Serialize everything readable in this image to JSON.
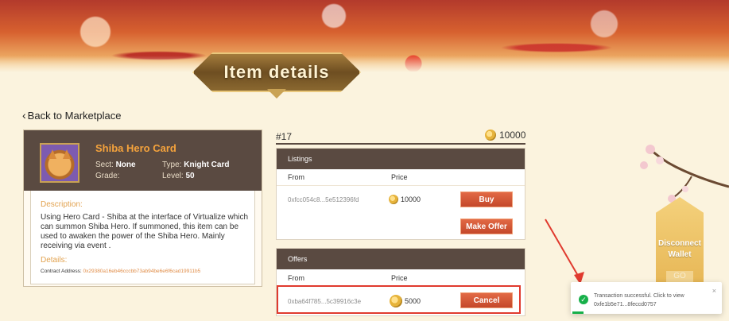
{
  "page": {
    "title": "Item details"
  },
  "nav": {
    "back_label": "Back to Marketplace",
    "back_icon": "chevron-left-icon"
  },
  "hero": {
    "name": "Shiba Hero Card",
    "sect_label": "Sect:",
    "sect_value": "None",
    "type_label": "Type:",
    "type_value": "Knight Card",
    "grade_label": "Grade:",
    "grade_value": "",
    "level_label": "Level:",
    "level_value": "50",
    "description_label": "Description:",
    "description": "Using Hero Card - Shiba at the interface of Virtualize which can summon Shiba Hero. If summoned, this item can be used to awaken the power of the Shiba Hero. Mainly receiving via event .",
    "details_label": "Details:",
    "contract_label": "Contract Address:",
    "contract_value": "0x29380a16eb46cccbb73ab94be6e6f6cad19911b5"
  },
  "item": {
    "id": "#17",
    "price": "10000"
  },
  "listings": {
    "title": "Listings",
    "col_from": "From",
    "col_price": "Price",
    "rows": [
      {
        "from": "0xfcc054c8...5e512396fd",
        "price": "10000",
        "action": "Buy"
      }
    ],
    "make_offer_label": "Make Offer"
  },
  "offers": {
    "title": "Offers",
    "col_from": "From",
    "col_price": "Price",
    "rows": [
      {
        "from": "0xba64f785...5c39916c3e",
        "price": "5000",
        "action": "Cancel"
      }
    ]
  },
  "wallet": {
    "disconnect_label_1": "Disconnect",
    "disconnect_label_2": "Wallet",
    "go_label": "GO"
  },
  "toast": {
    "line1": "Transaction successful. Click to view",
    "line2": "0xfe1b5e71...8feccd0757",
    "close": "×",
    "status_color": "#17b04a"
  },
  "colors": {
    "accent": "#c4472a",
    "header_bg": "#5a4a41",
    "highlight": "#e03a2e",
    "hero_name": "#f5a33c"
  }
}
